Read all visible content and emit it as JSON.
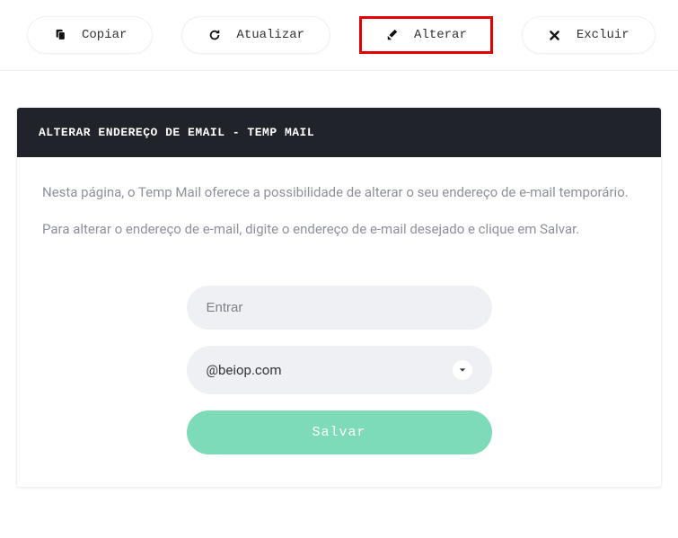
{
  "toolbar": {
    "copy_label": "Copiar",
    "refresh_label": "Atualizar",
    "change_label": "Alterar",
    "delete_label": "Excluir"
  },
  "card": {
    "header": "ALTERAR ENDEREÇO DE EMAIL - TEMP MAIL",
    "desc1": "Nesta página, o Temp Mail oferece a possibilidade de alterar o seu endereço de e-mail temporário.",
    "desc2": "Para alterar o endereço de e-mail, digite o endereço de e-mail desejado e clique em Salvar."
  },
  "form": {
    "input_placeholder": "Entrar",
    "domain_selected": "@beiop.com",
    "save_label": "Salvar"
  }
}
